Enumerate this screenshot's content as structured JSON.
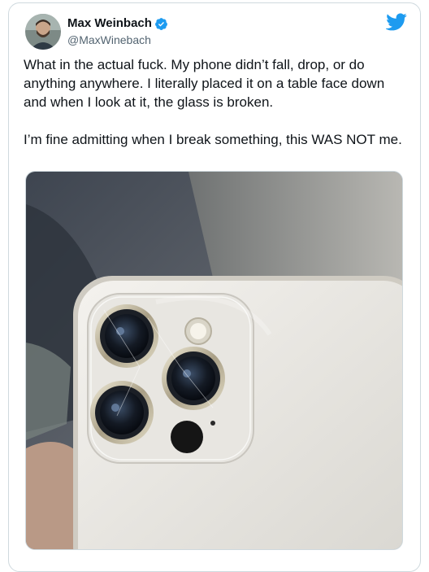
{
  "tweet": {
    "author": {
      "display_name": "Max Weinbach",
      "handle": "@MaxWinebach",
      "verified": true
    },
    "text": "What in the actual fuck. My phone didn’t fall, drop, or do anything anywhere. I literally placed it on a table face down and when I look at it, the glass is broken.\n\nI’m fine admitting when I break something, this WAS NOT me.",
    "brand_color": "#1d9bf0"
  },
  "icons": {
    "logo": "twitter-bird-icon",
    "badge": "verified-badge-icon"
  }
}
